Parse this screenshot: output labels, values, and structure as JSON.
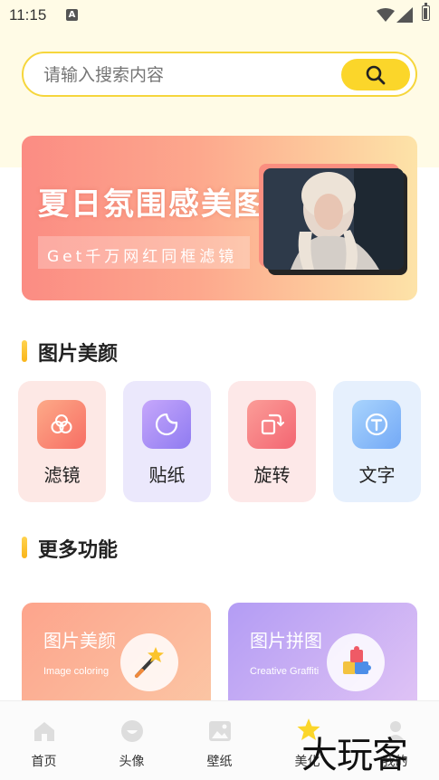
{
  "status_bar": {
    "time": "11:15"
  },
  "search": {
    "placeholder": "请输入搜索内容"
  },
  "banner": {
    "title": "夏日氛围感美图",
    "subtitle": "Get千万网红同框滤镜"
  },
  "sections": {
    "beauty_title": "图片美颜",
    "more_title": "更多功能"
  },
  "tools": [
    {
      "label": "滤镜",
      "icon": "filter-icon"
    },
    {
      "label": "贴纸",
      "icon": "sticker-icon"
    },
    {
      "label": "旋转",
      "icon": "rotate-icon"
    },
    {
      "label": "文字",
      "icon": "text-icon"
    }
  ],
  "features": [
    {
      "title": "图片美颜",
      "subtitle": "Image coloring",
      "icon": "magic-wand-icon"
    },
    {
      "title": "图片拼图",
      "subtitle": "Creative Graffiti",
      "icon": "puzzle-icon"
    }
  ],
  "nav": [
    {
      "label": "首页",
      "icon": "home-icon"
    },
    {
      "label": "头像",
      "icon": "avatar-icon"
    },
    {
      "label": "壁纸",
      "icon": "wallpaper-icon"
    },
    {
      "label": "美化",
      "icon": "star-icon",
      "active": true
    },
    {
      "label": "我的",
      "icon": "profile-icon"
    }
  ],
  "watermark": "大玩客",
  "colors": {
    "accent": "#fbd62a",
    "search_border": "#f6d63c",
    "banner_start": "#fb8c83",
    "banner_end": "#fde3a8"
  }
}
